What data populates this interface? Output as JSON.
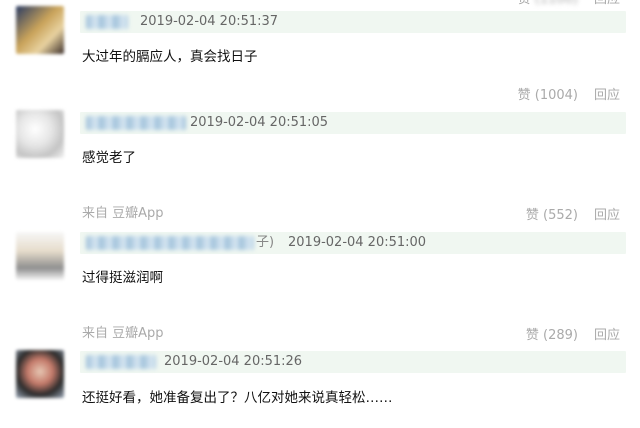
{
  "actions": {
    "like_label": "赞",
    "reply_label": "回应"
  },
  "comments": [
    {
      "timestamp": "2019-02-04 20:51:37",
      "content": "大过年的膈应人，真会找日子",
      "source": "",
      "likes": "(1004)",
      "avatar_colors": [
        "#2a3b63",
        "#c9a35a",
        "#e8d2a0"
      ]
    },
    {
      "timestamp": "2019-02-04 20:51:05",
      "content": "感觉老了",
      "source": "来自 豆瓣App",
      "likes": "(552)",
      "avatar_colors": [
        "#f2f2f2",
        "#d9d9d9",
        "#bdbdbd"
      ]
    },
    {
      "user_suffix": "子)",
      "timestamp": "2019-02-04 20:51:00",
      "content": "过得挺滋润啊",
      "source": "来自 豆瓣App",
      "likes": "(289)",
      "avatar_colors": [
        "#f7f7f7",
        "#e0d8c8",
        "#9a9a9a"
      ]
    },
    {
      "timestamp": "2019-02-04 20:51:26",
      "content": "还挺好看，她准备复出了？八亿对她来说真轻松……",
      "source": "",
      "likes": "",
      "avatar_colors": [
        "#2b2b2b",
        "#e6c7b3",
        "#c47a6a"
      ]
    }
  ]
}
